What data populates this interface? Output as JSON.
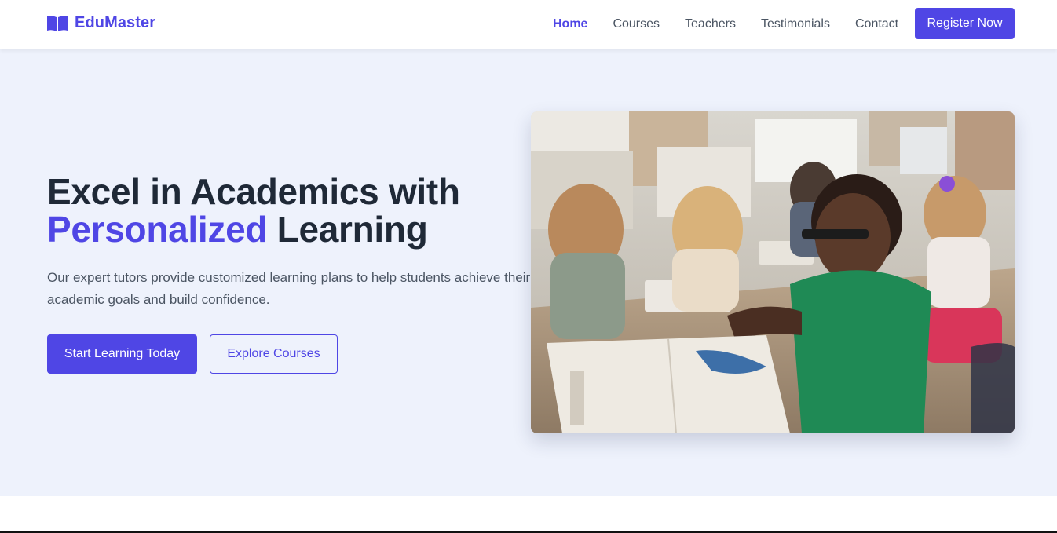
{
  "brand": {
    "name": "EduMaster",
    "icon": "open-book-icon",
    "color": "#4f46e5"
  },
  "nav": {
    "links": [
      {
        "label": "Home",
        "active": true
      },
      {
        "label": "Courses",
        "active": false
      },
      {
        "label": "Teachers",
        "active": false
      },
      {
        "label": "Testimonials",
        "active": false
      },
      {
        "label": "Contact",
        "active": false
      }
    ],
    "register_label": "Register Now"
  },
  "hero": {
    "title_line1": "Excel in Academics with",
    "title_accent": "Personalized",
    "title_rest": " Learning",
    "subtitle": "Our expert tutors provide customized learning plans to help students achieve their academic goals and build confidence.",
    "primary_cta": "Start Learning Today",
    "secondary_cta": "Explore Courses",
    "background": "#eef2fc"
  },
  "colors": {
    "accent": "#4f46e5",
    "heading": "#1f2937",
    "body_text": "#4b5563"
  }
}
